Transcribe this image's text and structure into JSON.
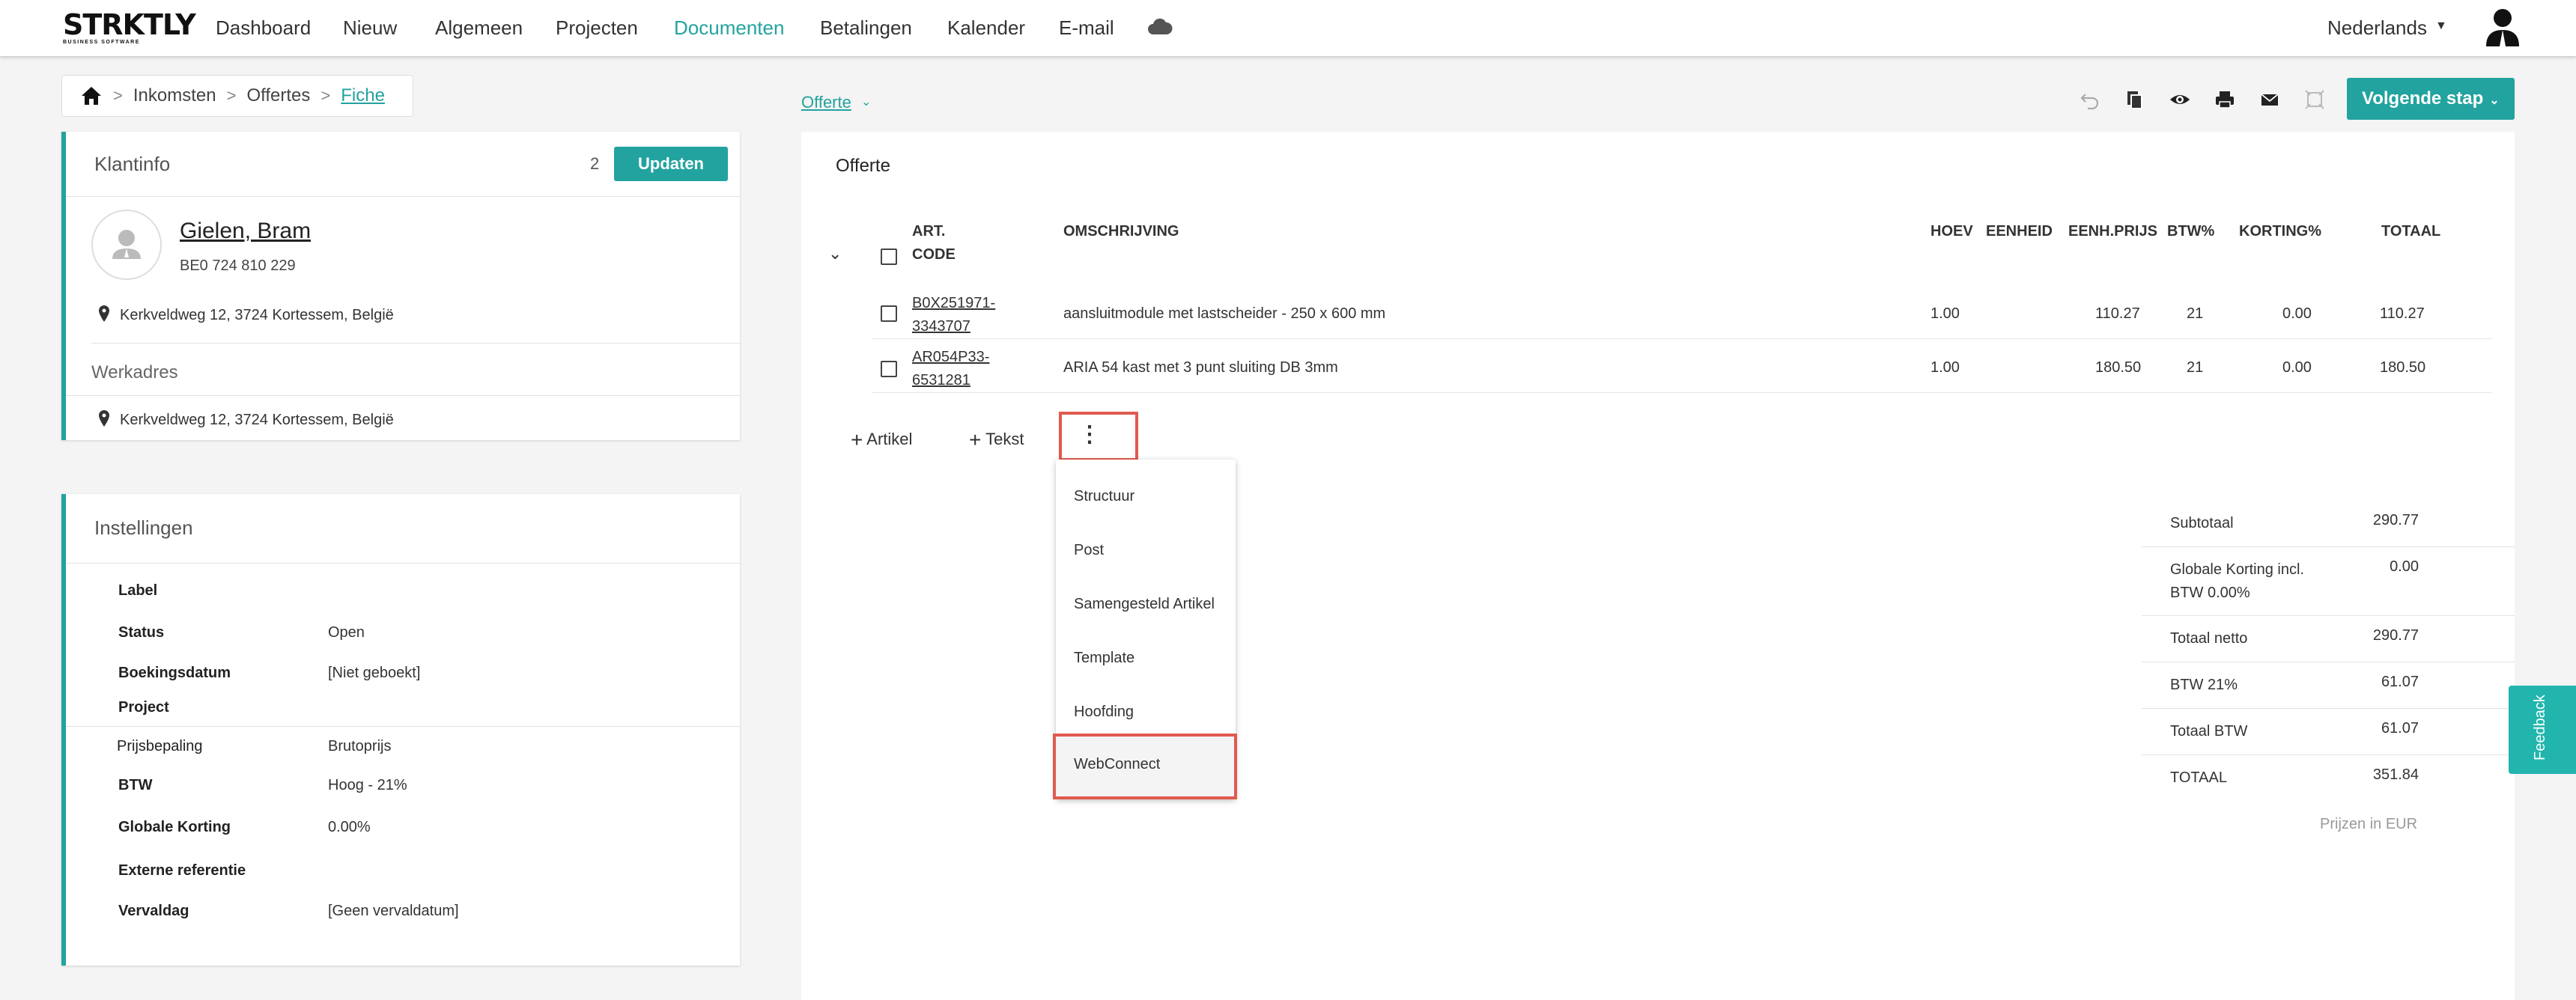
{
  "brand": {
    "name": "STRKTLY",
    "tagline": "BUSINESS SOFTWARE"
  },
  "nav": {
    "items": [
      {
        "label": "Dashboard"
      },
      {
        "label": "Nieuw"
      },
      {
        "label": "Algemeen"
      },
      {
        "label": "Projecten"
      },
      {
        "label": "Documenten",
        "active": true
      },
      {
        "label": "Betalingen"
      },
      {
        "label": "Kalender"
      },
      {
        "label": "E-mail"
      }
    ],
    "language": "Nederlands"
  },
  "breadcrumb": [
    "Inkomsten",
    "Offertes",
    "Fiche"
  ],
  "doc_type": "Offerte",
  "next_step": "Volgende stap",
  "klantinfo": {
    "title": "Klantinfo",
    "count": "2",
    "update_label": "Updaten",
    "name": "Gielen, Bram",
    "vat": "BE0 724 810 229",
    "address": "Kerkveldweg 12, 3724 Kortessem, België",
    "werkadres_title": "Werkadres",
    "werkadres": "Kerkveldweg 12, 3724 Kortessem, België"
  },
  "instellingen": {
    "title": "Instellingen",
    "rows": [
      {
        "label": "Label",
        "value": ""
      },
      {
        "label": "Status",
        "value": "Open"
      },
      {
        "label": "Boekingsdatum",
        "value": "[Niet geboekt]"
      },
      {
        "label": "Project",
        "value": ""
      },
      {
        "label": "Prijsbepaling",
        "value": "Brutoprijs"
      },
      {
        "label": "BTW",
        "value": "Hoog - 21%"
      },
      {
        "label": "Globale Korting",
        "value": "0.00%"
      },
      {
        "label": "Externe referentie",
        "value": ""
      },
      {
        "label": "Vervaldag",
        "value": "[Geen vervaldatum]"
      }
    ]
  },
  "offerte": {
    "title": "Offerte",
    "headers": {
      "code1": "ART.",
      "code2": "CODE",
      "desc": "OMSCHRIJVING",
      "qty": "HOEV",
      "unit": "EENHEID",
      "price": "EENH.PRIJS",
      "vat": "BTW%",
      "disc": "KORTING%",
      "total": "TOTAAL"
    },
    "lines": [
      {
        "code1": "B0X251971-",
        "code2": "3343707",
        "desc": "aansluitmodule met lastscheider - 250 x 600 mm",
        "qty": "1.00",
        "unit": "",
        "price": "110.27",
        "vat": "21",
        "disc": "0.00",
        "total": "110.27"
      },
      {
        "code1": "AR054P33-",
        "code2": "6531281",
        "desc": "ARIA 54 kast met 3 punt sluiting DB 3mm",
        "qty": "1.00",
        "unit": "",
        "price": "180.50",
        "vat": "21",
        "disc": "0.00",
        "total": "180.50"
      }
    ],
    "add_article": "Artikel",
    "add_text": "Tekst",
    "menu": [
      "Structuur",
      "Post",
      "Samengesteld Artikel",
      "Template",
      "Hoofding",
      "WebConnect"
    ]
  },
  "totals": {
    "subtotal_label": "Subtotaal",
    "subtotal": "290.77",
    "discount_label1": "Globale Korting incl.",
    "discount_label2": "BTW 0.00%",
    "discount": "0.00",
    "net_label": "Totaal netto",
    "net": "290.77",
    "vat21_label": "BTW 21%",
    "vat21": "61.07",
    "vat_total_label": "Totaal BTW",
    "vat_total": "61.07",
    "total_label": "TOTAAL",
    "total": "351.84",
    "currency_note": "Prijzen in EUR"
  },
  "feedback": "Feedback",
  "colors": {
    "accent": "#22a39f",
    "highlight": "#e05a4e"
  }
}
